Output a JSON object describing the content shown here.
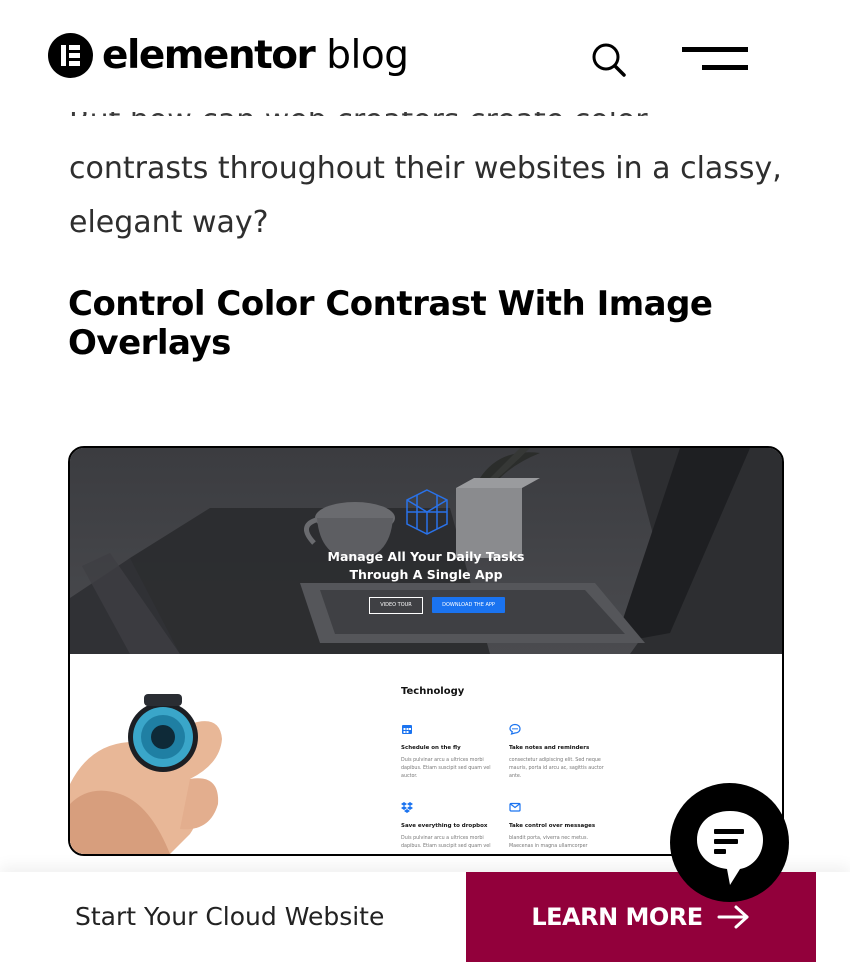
{
  "header": {
    "logo_word": "elementor",
    "logo_suffix": "blog",
    "search_icon": "search-icon",
    "menu_icon": "hamburger-menu-icon"
  },
  "article": {
    "cut_line": "But how can web creators create color",
    "paragraph": "contrasts throughout their websites in a classy, elegant way?",
    "heading": "Control Color Contrast With Image Overlays"
  },
  "figure": {
    "hero_title_line1": "Manage All Your Daily Tasks",
    "hero_title_line2": "Through A Single App",
    "video_button": "VIDEO TOUR",
    "download_button": "DOWNLOAD THE APP",
    "section_title": "Technology",
    "features": [
      {
        "icon": "calendar-icon",
        "title": "Schedule on the fly",
        "desc": "Duis pulvinar arcu a ultrices morbi dapibus. Etiam suscipit sed quam vel auctor."
      },
      {
        "icon": "chat-icon",
        "title": "Take notes and reminders",
        "desc": "consectetur adipiscing elit. Sed neque mauris, porta id arcu ac, sagittis auctor ante."
      },
      {
        "icon": "dropbox-icon",
        "title": "Save everything to dropbox",
        "desc": "Duis pulvinar arcu a ultrices morbi dapibus. Etiam suscipit sed quam vel"
      },
      {
        "icon": "envelope-icon",
        "title": "Take control over messages",
        "desc": "blandit porta, viverra nec metus. Maecenas in magna ullamcorper"
      }
    ],
    "accent_color": "#1a73f0"
  },
  "chat": {
    "icon": "chat-bubble-icon"
  },
  "footer": {
    "text": "Start Your Cloud Website",
    "cta_label": "LEARN MORE",
    "cta_icon": "arrow-right-icon",
    "cta_color": "#92003b"
  }
}
